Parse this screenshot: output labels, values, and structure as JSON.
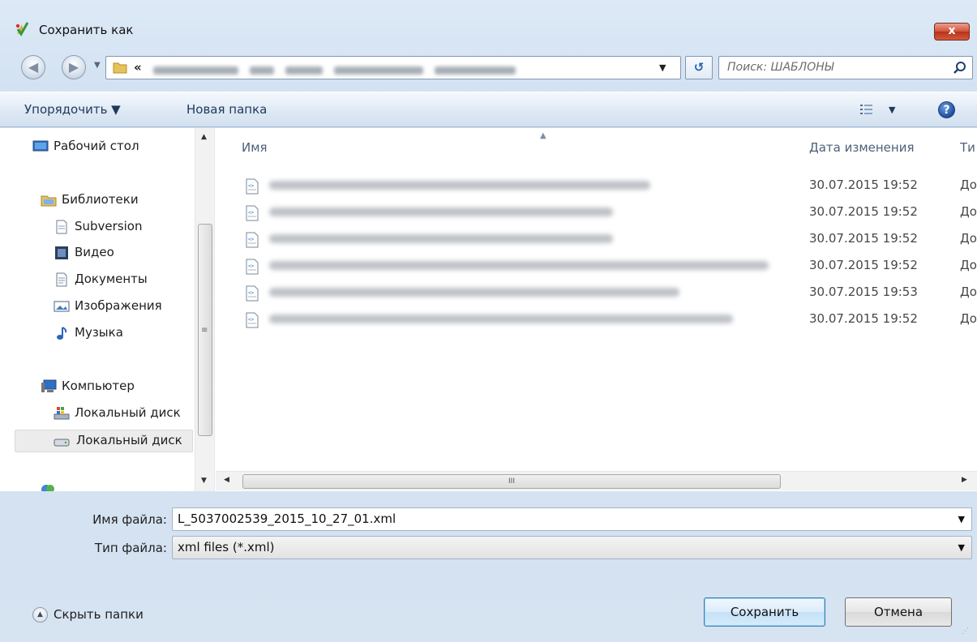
{
  "window": {
    "title": "Сохранить как",
    "close_label": "x"
  },
  "nav": {
    "back_icon": "back-arrow-icon",
    "forward_icon": "forward-arrow-icon",
    "breadcrumb_prefix": "«",
    "search_placeholder": "Поиск: ШАБЛОНЫ",
    "refresh_label": "↺"
  },
  "toolbar": {
    "organize_label": "Упорядочить ▼",
    "new_folder_label": "Новая папка",
    "help_label": "?"
  },
  "sidebar": {
    "items": [
      {
        "label": "Рабочий стол",
        "icon": "desktop-icon"
      },
      {
        "label": "Библиотеки",
        "icon": "libraries-icon"
      },
      {
        "label": "Subversion",
        "icon": "document-icon"
      },
      {
        "label": "Видео",
        "icon": "video-icon"
      },
      {
        "label": "Документы",
        "icon": "documents-icon"
      },
      {
        "label": "Изображения",
        "icon": "pictures-icon"
      },
      {
        "label": "Музыка",
        "icon": "music-icon"
      },
      {
        "label": "Компьютер",
        "icon": "computer-icon"
      },
      {
        "label": "Локальный диск",
        "icon": "system-disk-icon"
      },
      {
        "label": "Локальный диск",
        "icon": "disk-icon"
      }
    ]
  },
  "file_list": {
    "columns": [
      "Имя",
      "Дата изменения",
      "Ти"
    ],
    "rows": [
      {
        "date": "30.07.2015 19:52",
        "type": "До"
      },
      {
        "date": "30.07.2015 19:52",
        "type": "До"
      },
      {
        "date": "30.07.2015 19:52",
        "type": "До"
      },
      {
        "date": "30.07.2015 19:52",
        "type": "До"
      },
      {
        "date": "30.07.2015 19:53",
        "type": "До"
      },
      {
        "date": "30.07.2015 19:52",
        "type": "До"
      }
    ],
    "h_scroll_grip": "III"
  },
  "form": {
    "filename_label": "Имя файла:",
    "filename_value": "L_5037002539_2015_10_27_01.xml",
    "filetype_label": "Тип файла:",
    "filetype_value": "xml files (*.xml)"
  },
  "footer": {
    "hide_folders_label": "Скрыть папки",
    "save_label": "Сохранить",
    "cancel_label": "Отмена"
  },
  "colors": {
    "accent": "#3c7fb1",
    "close_red": "#c7462b",
    "window_bg": "#d6e3f1"
  }
}
